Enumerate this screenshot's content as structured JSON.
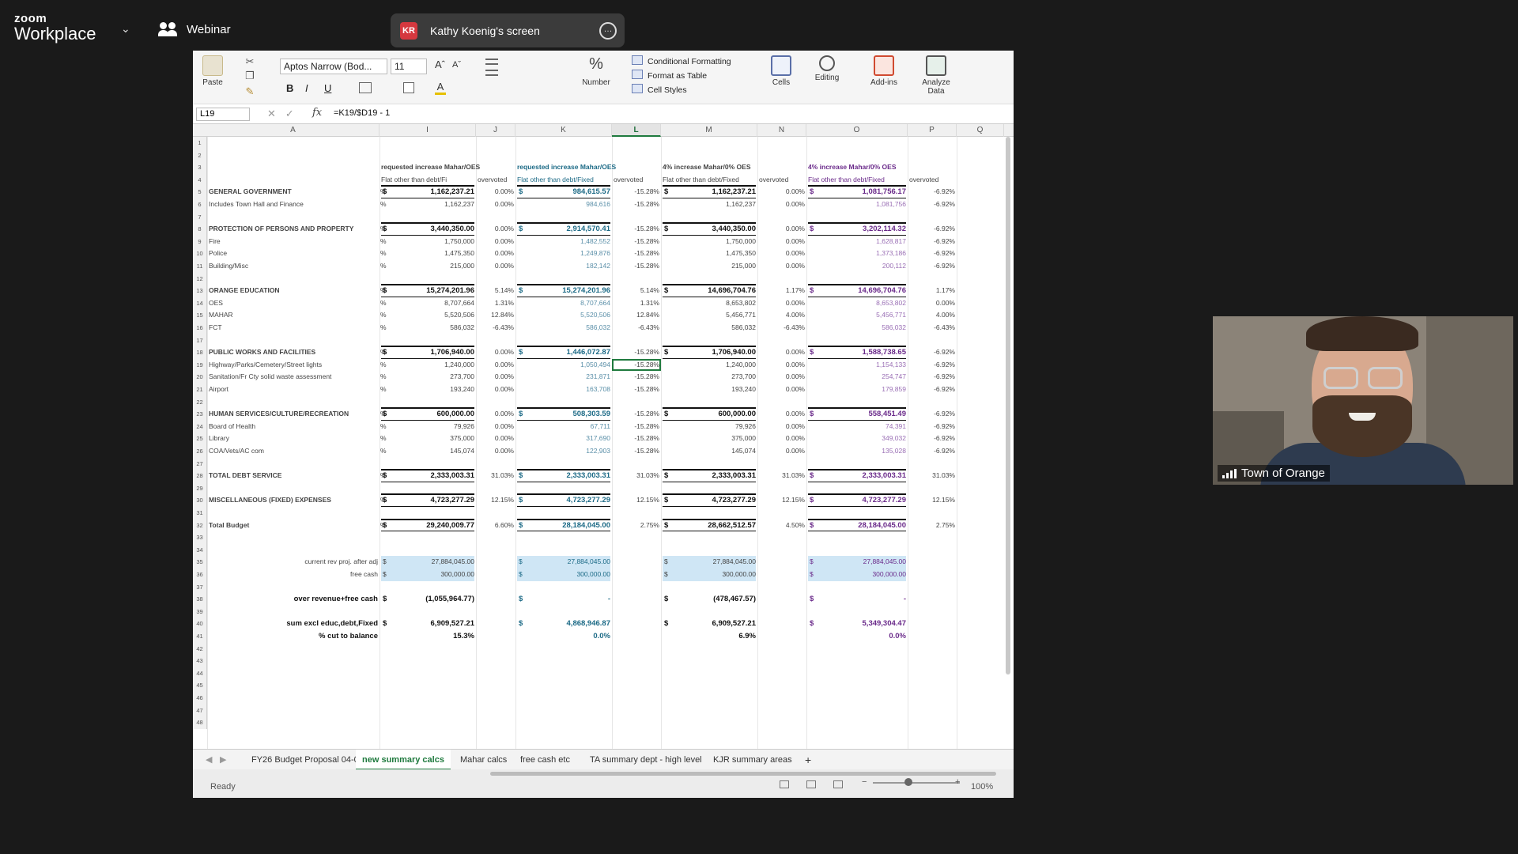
{
  "zoom": {
    "brand_top": "zoom",
    "brand_bottom": "Workplace",
    "webinar_label": "Webinar",
    "share_initials": "KR",
    "share_label": "Kathy Koenig's screen",
    "participant_name": "Town of Orange",
    "share_color": "#d5383f"
  },
  "excel": {
    "ribbon": {
      "paste": "Paste",
      "font_name": "Aptos Narrow (Bod...",
      "font_size": "11",
      "bold": "B",
      "italic": "I",
      "underline": "U",
      "number": "Number",
      "conditional_formatting": "Conditional Formatting",
      "format_as_table": "Format as Table",
      "cell_styles": "Cell Styles",
      "cells": "Cells",
      "editing": "Editing",
      "addins": "Add-ins",
      "analyze": "Analyze Data"
    },
    "name_box": "L19",
    "formula": "=K19/$D19 - 1",
    "columns": [
      "A",
      "I",
      "J",
      "K",
      "L",
      "M",
      "N",
      "O",
      "P",
      "Q"
    ],
    "groups": {
      "g1": "requested increase Mahar/OES",
      "g2": "requested increase Mahar/OES",
      "g3": "4% increase Mahar/0% OES",
      "g4": "4% increase Mahar/0% OES"
    },
    "sub": {
      "flat": "Flat other than debt/Fixed",
      "flat_short": "Flat other than debt/Fi",
      "overvoted": "overvoted"
    },
    "rows": {
      "r5": {
        "label": "GENERAL GOVERNMENT",
        "i": "1,162,237.21",
        "j": "0.00%",
        "k": "984,615.57",
        "l": "-15.28%",
        "m": "1,162,237.21",
        "n": "0.00%",
        "o": "1,081,756.17",
        "p": "-6.92%"
      },
      "r6": {
        "label": "Includes Town Hall and Finance",
        "i": "1,162,237",
        "j": "0.00%",
        "k": "984,616",
        "l": "-15.28%",
        "m": "1,162,237",
        "n": "0.00%",
        "o": "1,081,756",
        "p": "-6.92%"
      },
      "r8": {
        "label": "PROTECTION OF PERSONS AND PROPERTY",
        "i": "3,440,350.00",
        "j": "0.00%",
        "k": "2,914,570.41",
        "l": "-15.28%",
        "m": "3,440,350.00",
        "n": "0.00%",
        "o": "3,202,114.32",
        "p": "-6.92%"
      },
      "r9": {
        "label": "Fire",
        "i": "1,750,000",
        "j": "0.00%",
        "k": "1,482,552",
        "l": "-15.28%",
        "m": "1,750,000",
        "n": "0.00%",
        "o": "1,628,817",
        "p": "-6.92%"
      },
      "r10": {
        "label": "Police",
        "i": "1,475,350",
        "j": "0.00%",
        "k": "1,249,876",
        "l": "-15.28%",
        "m": "1,475,350",
        "n": "0.00%",
        "o": "1,373,186",
        "p": "-6.92%"
      },
      "r11": {
        "label": "Building/Misc",
        "i": "215,000",
        "j": "0.00%",
        "k": "182,142",
        "l": "-15.28%",
        "m": "215,000",
        "n": "0.00%",
        "o": "200,112",
        "p": "-6.92%"
      },
      "r13": {
        "label": "ORANGE EDUCATION",
        "i": "15,274,201.96",
        "j": "5.14%",
        "k": "15,274,201.96",
        "l": "5.14%",
        "m": "14,696,704.76",
        "n": "1.17%",
        "o": "14,696,704.76",
        "p": "1.17%"
      },
      "r14": {
        "label": "OES",
        "i": "8,707,664",
        "j": "1.31%",
        "k": "8,707,664",
        "l": "1.31%",
        "m": "8,653,802",
        "n": "0.00%",
        "o": "8,653,802",
        "p": "0.00%"
      },
      "r15": {
        "label": "MAHAR",
        "i": "5,520,506",
        "j": "12.84%",
        "k": "5,520,506",
        "l": "12.84%",
        "m": "5,456,771",
        "n": "4.00%",
        "o": "5,456,771",
        "p": "4.00%"
      },
      "r16": {
        "label": "FCT",
        "i": "586,032",
        "j": "-6.43%",
        "k": "586,032",
        "l": "-6.43%",
        "m": "586,032",
        "n": "-6.43%",
        "o": "586,032",
        "p": "-6.43%"
      },
      "r18": {
        "label": "PUBLIC WORKS AND FACILITIES",
        "i": "1,706,940.00",
        "j": "0.00%",
        "k": "1,446,072.87",
        "l": "-15.28%",
        "m": "1,706,940.00",
        "n": "0.00%",
        "o": "1,588,738.65",
        "p": "-6.92%"
      },
      "r19": {
        "label": "Highway/Parks/Cemetery/Street lights",
        "i": "1,240,000",
        "j": "0.00%",
        "k": "1,050,494",
        "l": "-15.28%",
        "m": "1,240,000",
        "n": "0.00%",
        "o": "1,154,133",
        "p": "-6.92%"
      },
      "r20": {
        "label": "Sanitation/Fr Cty solid waste assessment",
        "i": "273,700",
        "j": "0.00%",
        "k": "231,871",
        "l": "-15.28%",
        "m": "273,700",
        "n": "0.00%",
        "o": "254,747",
        "p": "-6.92%"
      },
      "r21": {
        "label": "Airport",
        "i": "193,240",
        "j": "0.00%",
        "k": "163,708",
        "l": "-15.28%",
        "m": "193,240",
        "n": "0.00%",
        "o": "179,859",
        "p": "-6.92%"
      },
      "r23": {
        "label": "HUMAN SERVICES/CULTURE/RECREATION",
        "i": "600,000.00",
        "j": "0.00%",
        "k": "508,303.59",
        "l": "-15.28%",
        "m": "600,000.00",
        "n": "0.00%",
        "o": "558,451.49",
        "p": "-6.92%"
      },
      "r24": {
        "label": "Board of Health",
        "i": "79,926",
        "j": "0.00%",
        "k": "67,711",
        "l": "-15.28%",
        "m": "79,926",
        "n": "0.00%",
        "o": "74,391",
        "p": "-6.92%"
      },
      "r25": {
        "label": "Library",
        "i": "375,000",
        "j": "0.00%",
        "k": "317,690",
        "l": "-15.28%",
        "m": "375,000",
        "n": "0.00%",
        "o": "349,032",
        "p": "-6.92%"
      },
      "r26": {
        "label": "COA/Vets/AC com",
        "i": "145,074",
        "j": "0.00%",
        "k": "122,903",
        "l": "-15.28%",
        "m": "145,074",
        "n": "0.00%",
        "o": "135,028",
        "p": "-6.92%"
      },
      "r28": {
        "label": "TOTAL DEBT SERVICE",
        "i": "2,333,003.31",
        "j": "31.03%",
        "k": "2,333,003.31",
        "l": "31.03%",
        "m": "2,333,003.31",
        "n": "31.03%",
        "o": "2,333,003.31",
        "p": "31.03%"
      },
      "r30": {
        "label": "MISCELLANEOUS (FIXED) EXPENSES",
        "i": "4,723,277.29",
        "j": "12.15%",
        "k": "4,723,277.29",
        "l": "12.15%",
        "m": "4,723,277.29",
        "n": "12.15%",
        "o": "4,723,277.29",
        "p": "12.15%"
      },
      "r32": {
        "label": "Total Budget",
        "i": "29,240,009.77",
        "j": "6.60%",
        "k": "28,184,045.00",
        "l": "2.75%",
        "m": "28,662,512.57",
        "n": "4.50%",
        "o": "28,184,045.00",
        "p": "2.75%"
      }
    },
    "summary": {
      "rev_label": "current rev proj. after adj",
      "freecash_label": "free cash",
      "over_label": "over revenue+free cash",
      "sum_label": "sum excl educ,debt,Fixed",
      "pct_label": "% cut to balance",
      "rev": [
        "27,884,045.00",
        "27,884,045.00",
        "27,884,045.00",
        "27,884,045.00"
      ],
      "freecash": [
        "300,000.00",
        "300,000.00",
        "300,000.00",
        "300,000.00"
      ],
      "over": [
        "(1,055,964.77)",
        "-",
        "(478,467.57)",
        "-"
      ],
      "sum": [
        "6,909,527.21",
        "4,868,946.87",
        "6,909,527.21",
        "5,349,304.47"
      ],
      "pct": [
        "15.3%",
        "0.0%",
        "6.9%",
        "0.0%"
      ]
    },
    "row_cut_prefix": "%",
    "dollar": "$",
    "tabs": [
      "FY26 Budget Proposal 04-01",
      "new summary calcs",
      "Mahar calcs",
      "free cash etc",
      "TA summary dept - high level",
      "KJR summary areas"
    ],
    "add_tab": "+",
    "status": "Ready",
    "zoom_level": "100%"
  }
}
